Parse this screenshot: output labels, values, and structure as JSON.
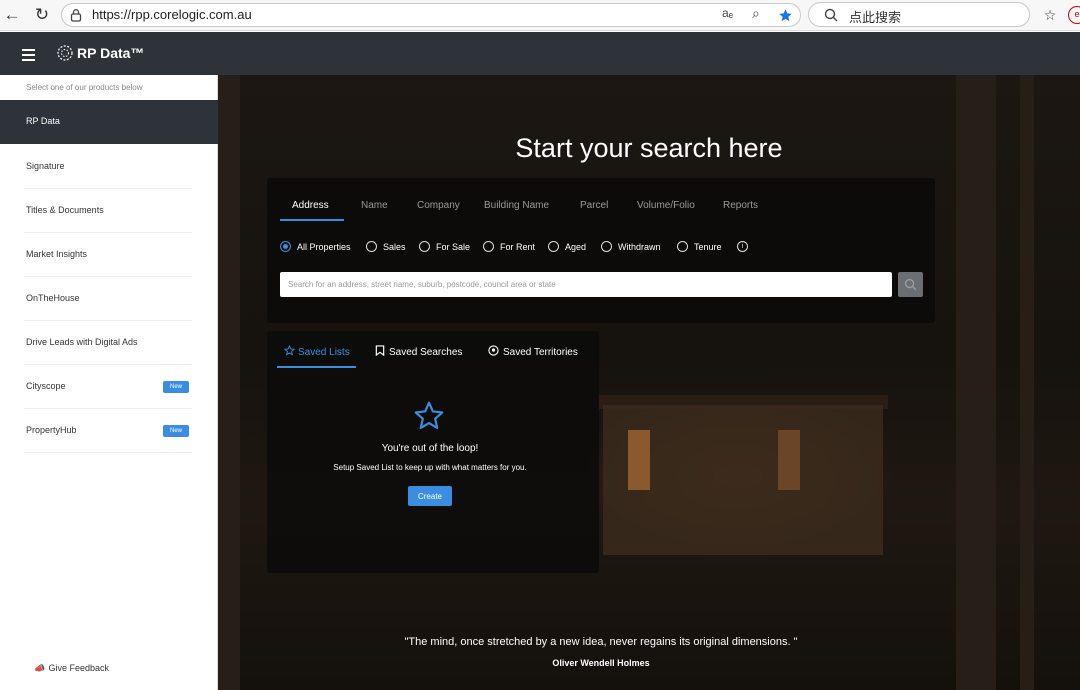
{
  "browser": {
    "url": "https://rpp.corelogic.com.au",
    "search_placeholder": "点此搜索"
  },
  "header": {
    "brand": "RP Data™"
  },
  "sidebar": {
    "hint": "Select one of our products below",
    "items": [
      {
        "label": "RP Data",
        "active": true
      },
      {
        "label": "Signature"
      },
      {
        "label": "Titles & Documents"
      },
      {
        "label": "Market Insights"
      },
      {
        "label": "OnTheHouse"
      },
      {
        "label": "Drive Leads with Digital Ads"
      },
      {
        "label": "Cityscope",
        "badge": "New"
      },
      {
        "label": "PropertyHub",
        "badge": "New"
      }
    ],
    "feedback": "Give Feedback"
  },
  "hero": {
    "title": "Start your search here"
  },
  "search": {
    "tabs": [
      "Address",
      "Name",
      "Company",
      "Building Name",
      "Parcel",
      "Volume/Folio",
      "Reports"
    ],
    "radios": [
      "All Properties",
      "Sales",
      "For Sale",
      "For Rent",
      "Aged",
      "Withdrawn",
      "Tenure"
    ],
    "placeholder": "Search for an address, street name, suburb, postcode, council area or state"
  },
  "saved": {
    "tabs": [
      "Saved Lists",
      "Saved Searches",
      "Saved Territories"
    ],
    "empty_title": "You're out of the loop!",
    "empty_sub": "Setup Saved List to keep up with what matters for you.",
    "create_label": "Create"
  },
  "quote": {
    "text": "\"The mind, once stretched by a new idea, never regains its original dimensions. \"",
    "author": "Oliver Wendell Holmes"
  },
  "colors": {
    "accent": "#3a8de0",
    "header_bg": "#2d3338"
  }
}
